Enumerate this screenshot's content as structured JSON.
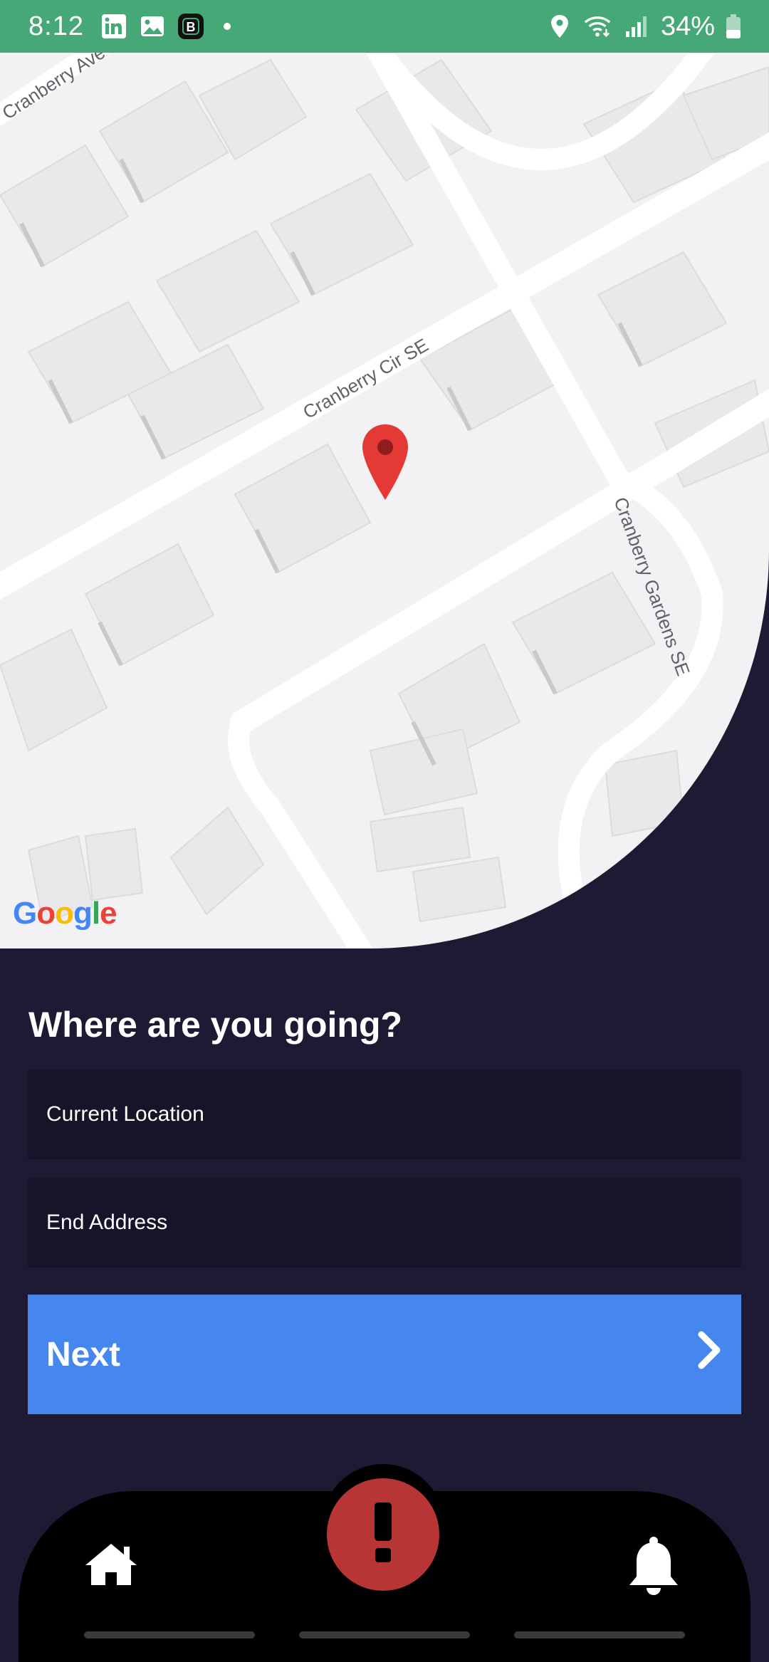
{
  "status_bar": {
    "time": "8:12",
    "battery_percent": "34%",
    "left_icons": [
      "linkedin-icon",
      "gallery-icon",
      "b-app-icon",
      "notification-dot"
    ],
    "right_icons": [
      "location-icon",
      "wifi-icon",
      "signal-icon",
      "battery-icon"
    ],
    "background_color": "#47a877"
  },
  "map": {
    "street_labels": [
      "Cranberry Ave",
      "Cranberry Cir SE",
      "Cranberry Gardens SE"
    ],
    "attribution": [
      "G",
      "o",
      "o",
      "g",
      "l",
      "e"
    ],
    "attribution_colors": [
      "#4285F4",
      "#EA4335",
      "#FBBC05",
      "#4285F4",
      "#34A853",
      "#EA4335"
    ],
    "pin_color": "#e53935"
  },
  "form": {
    "heading": "Where are you going?",
    "start_placeholder": "Current Location",
    "end_placeholder": "End Address",
    "next_label": "Next"
  },
  "bottom_nav": {
    "items": [
      "home-icon",
      "alert-icon",
      "bell-icon"
    ],
    "alert_color": "#b73535"
  },
  "colors": {
    "background": "#1c1b33",
    "field_background": "#151429",
    "button": "#4586ef"
  }
}
